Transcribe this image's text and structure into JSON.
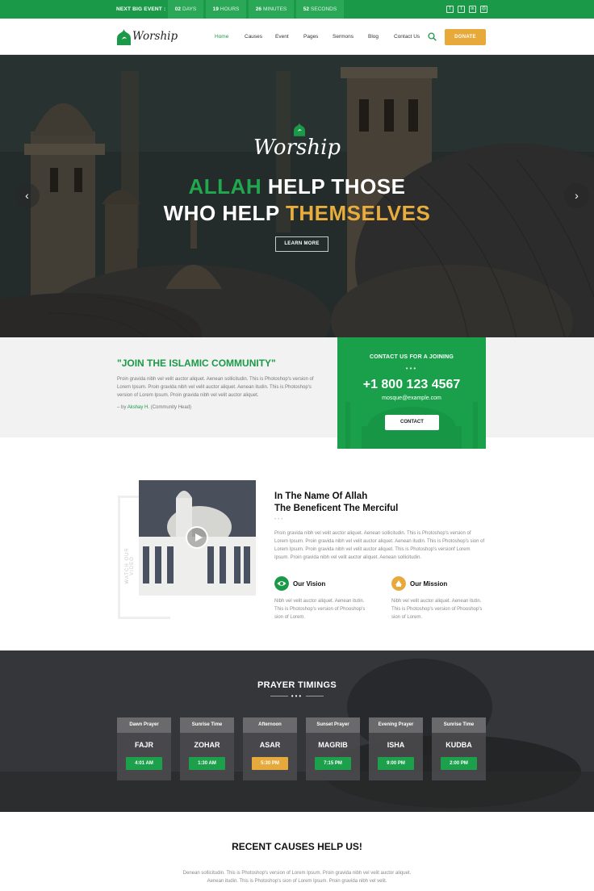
{
  "topbar": {
    "event_label": "NEXT BIG EVENT :",
    "countdown": [
      {
        "value": "02",
        "unit": "DAYS"
      },
      {
        "value": "19",
        "unit": "HOURS"
      },
      {
        "value": "26",
        "unit": "MINUTES"
      },
      {
        "value": "52",
        "unit": "SECONDS"
      }
    ],
    "social": [
      {
        "icon": "facebook-icon",
        "glyph": "f"
      },
      {
        "icon": "twitter-icon",
        "glyph": "t"
      },
      {
        "icon": "linkedin-icon",
        "glyph": "in"
      },
      {
        "icon": "instagram-icon",
        "glyph": "◎"
      }
    ]
  },
  "nav": {
    "logo_text": "Worship",
    "items": [
      "Home",
      "Causes",
      "Event",
      "Pages",
      "Sermons",
      "Blog",
      "Contact Us"
    ],
    "active": "Home",
    "donate_label": "DONATE"
  },
  "hero": {
    "logo_text": "Worship",
    "line1_green": "ALLAH",
    "line1_rest": "HELP THOSE",
    "line2_rest": "WHO HELP",
    "line2_yellow": "THEMSELVES",
    "button_label": "LEARN MORE",
    "prev_icon": "chevron-left-icon",
    "next_icon": "chevron-right-icon"
  },
  "community": {
    "title": "\"JOIN THE ISLAMIC COMMUNITY\"",
    "text": "Proin gravida nibh vel velit auctor aliquet. Aenean sollicitudin. This is Photoshop's version of Lorem Ipsum. Proin gravida nibh vel velit auctor aliquet. Aenean itudin. This is Photoshop's version of Lorem Ipsum. Proin gravida nibh vel velit auctor aliquet.",
    "author_prefix": "– by",
    "author_name": "Akshay H.",
    "author_role": "(Community Head)"
  },
  "contact": {
    "label": "CONTACT US FOR A JOINING",
    "dots": "•••",
    "phone": "+1 800 123 4567",
    "email": "mosque@example.com",
    "button_label": "CONTACT"
  },
  "about": {
    "watch_label": "WATCH OUR VIDEO",
    "title_line1": "In The Name Of Allah",
    "title_line2": "The Beneficent The Merciful",
    "dots": "•••",
    "text": "Proin gravida nibh vel velit auctor aliquet. Aenean sollicitudin. This is Photoshop's version of Lorem Ipsum. Proin gravida nibh vel velit auctor aliquet. Aenean itudin. This is Photoshop's sion of Lorem Ipsum. Proin gravida nibh vel velit auctor aliquet. This is Photoshop's versionf Lorem Ipsum. Proin gravida nibh vel velit auctor aliquet. Aenean sollicitudin.",
    "vision_title": "Our Vision",
    "vision_text": "Nibh vel velit auctor aliquet. Aenean itutin. This is Photoshop's version of Phooshop's sion of Lorem.",
    "mission_title": "Our Mission",
    "mission_text": "Nibh vel velit auctor aliquet. Aenean itutin. This is Photoshop's version of Phooshop's sion of Lorem."
  },
  "prayer": {
    "title": "PRAYER TIMINGS",
    "deco": "•••",
    "cards": [
      {
        "head": "Dawn Prayer",
        "name": "FAJR",
        "time": "4:01 AM",
        "highlight": false
      },
      {
        "head": "Sunrise Time",
        "name": "ZOHAR",
        "time": "1:30 AM",
        "highlight": false
      },
      {
        "head": "Afternoon",
        "name": "ASAR",
        "time": "5:30 PM",
        "highlight": true
      },
      {
        "head": "Sunset Prayer",
        "name": "MAGRIB",
        "time": "7:15 PM",
        "highlight": false
      },
      {
        "head": "Evening Prayer",
        "name": "ISHA",
        "time": "9:00 PM",
        "highlight": false
      },
      {
        "head": "Sunrise Time",
        "name": "KUDBA",
        "time": "2:00 PM",
        "highlight": false
      }
    ]
  },
  "causes": {
    "title": "RECENT CAUSES HELP US!",
    "text_line1": "Denean sollicitudin. This is Photoshop's version of Lorem Ipsum. Proin gravida nibh vel velit auctor aliquet.",
    "text_line2": "Aenean itudin. This is Photoshop's sion of Lorem Ipsum. Proin gravida nibh vel velit."
  },
  "colors": {
    "brand_green": "#1a9a48",
    "accent_yellow": "#e8a93b"
  }
}
